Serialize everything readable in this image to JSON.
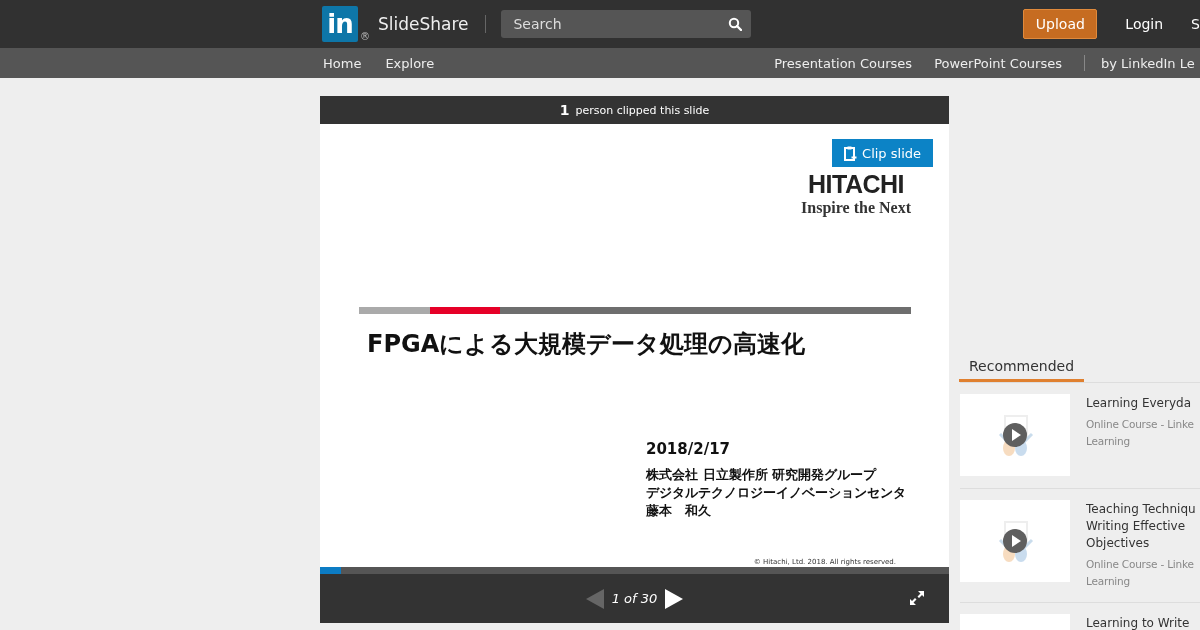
{
  "header": {
    "logo_mark": "in",
    "logo_registered": "®",
    "brand": "SlideShare",
    "search": {
      "placeholder": "Search"
    },
    "upload": "Upload",
    "login": "Login",
    "signup_cut": "S"
  },
  "subnav": {
    "left": [
      "Home",
      "Explore"
    ],
    "right": [
      "Presentation Courses",
      "PowerPoint Courses"
    ],
    "partner_cut": "by LinkedIn Le"
  },
  "player": {
    "clip_count": "1",
    "clip_text": "person clipped this slide",
    "clip_button": "Clip slide",
    "slide": {
      "logo": "HITACHI",
      "tagline": "Inspire the Next",
      "title": "FPGAによる大規模データ処理の高速化",
      "date": "2018/2/17",
      "author_lines": [
        "株式会社 日立製作所 研究開発グループ",
        "デジタルテクノロジーイノベーションセンタ",
        "藤本　和久"
      ],
      "copyright": "© Hitachi, Ltd. 2018. All rights reserved."
    },
    "progress": {
      "level": 0.033
    },
    "prev_disabled": true,
    "page": "1 of 30"
  },
  "recommended": {
    "tab": "Recommended",
    "items": [
      {
        "title_lines": [
          "Learning Everyda"
        ],
        "meta_lines": [
          "Online Course - Linke",
          "Learning"
        ]
      },
      {
        "title_lines": [
          "Teaching Techniqu",
          "Writing Effective",
          "Objectives"
        ],
        "meta_lines": [
          "Online Course - Linke",
          "Learning"
        ]
      },
      {
        "title_lines": [
          "Learning to Write"
        ]
      }
    ]
  }
}
